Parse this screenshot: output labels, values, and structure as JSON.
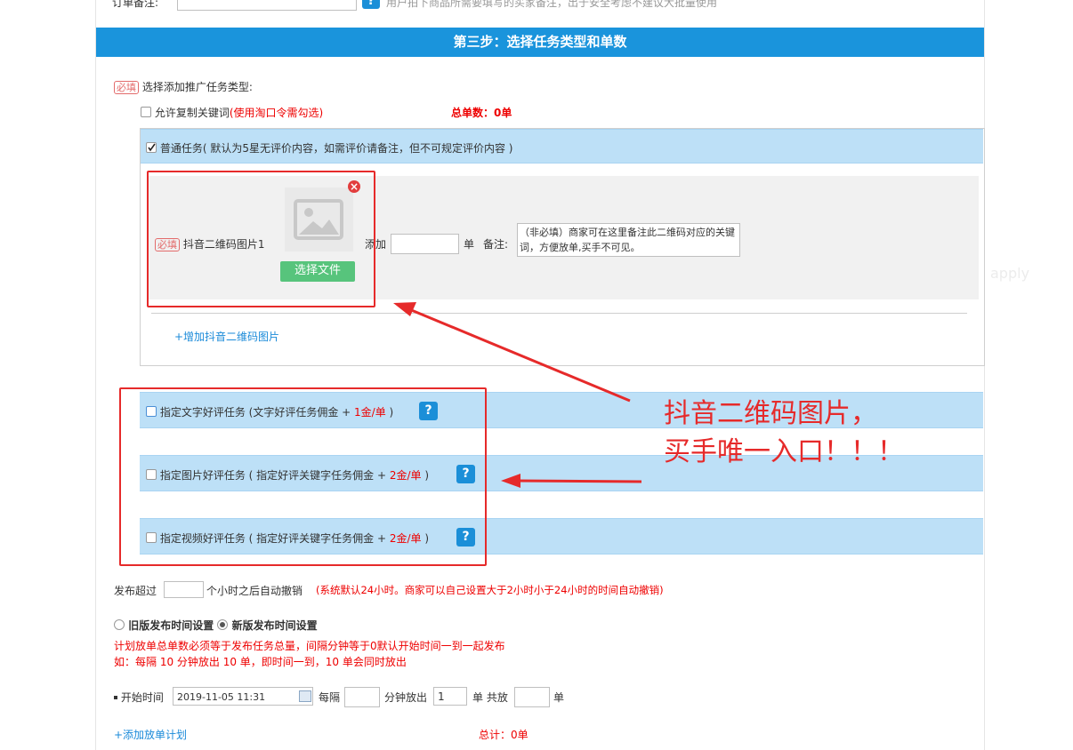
{
  "top": {
    "label": "订单备注:",
    "hint": "用户拍下商品所需要填写的买家备注，出于安全考虑不建议大批量使用",
    "help": "?"
  },
  "step3": {
    "title": "第三步：选择任务类型和单数"
  },
  "section": {
    "required_tag": "必填",
    "label": "选择添加推广任务类型:",
    "allow_copy_prefix": "允许复制关键词",
    "allow_copy_note": "(使用淘口令需勾选)",
    "total_orders": "总单数：0单"
  },
  "normal_task": {
    "label": "普通任务( 默认为5星无评价内容，如需评价请备注，但不可规定评价内容 )",
    "qr_label": "抖音二维码图片1",
    "choose_file": "选择文件",
    "add_label": "添加",
    "unit": "单",
    "remark_label": "备注:",
    "remark_placeholder": "（非必填）商家可在这里备注此二维码对应的关键词，方便放单,买手不可见。",
    "add_qr_link": "+增加抖音二维码图片"
  },
  "watermark": "apply",
  "review_tasks": [
    {
      "label": "指定文字好评任务 (文字好评任务佣金 + ",
      "price": "1金/单",
      "suffix": " )"
    },
    {
      "label": "指定图片好评任务 ( 指定好评关键字任务佣金 + ",
      "price": "2金/单",
      "suffix": " )"
    },
    {
      "label": "指定视频好评任务 ( 指定好评关键字任务佣金 + ",
      "price": "2金/单",
      "suffix": " )"
    }
  ],
  "annotation": {
    "line1": "抖音二维码图片，",
    "line2": "买手唯一入口！！！"
  },
  "cancel": {
    "prefix": "发布超过",
    "suffix": "个小时之后自动撤销",
    "note": "(系统默认24小时。商家可以自己设置大于2小时小于24小时的时间自动撤销)"
  },
  "schedule": {
    "old_label": "旧版发布时间设置",
    "new_label": "新版发布时间设置",
    "rule1": "计划放单总单数必须等于发布任务总量，间隔分钟等于0默认开始时间一到一起发布",
    "rule2": "如：每隔 10 分钟放出 10 单，即时间一到，10 单会同时放出",
    "start_label": "开始时间",
    "start_value": "2019-11-05 11:31",
    "every_label": "每隔",
    "minutes_label": "分钟放出",
    "release_value": "1",
    "unit_total": "单 共放",
    "unit_end": "单",
    "add_plan": "+添加放单计划",
    "total": "总计：0单"
  }
}
